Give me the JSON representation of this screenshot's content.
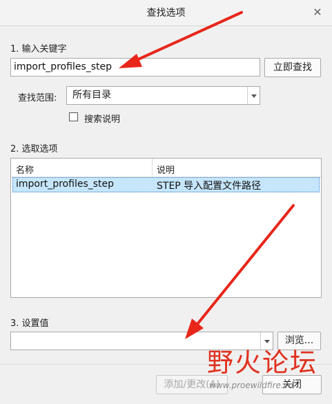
{
  "window": {
    "title": "查找选项",
    "close_glyph": "✕"
  },
  "step1": {
    "label": "1. 输入关键字",
    "keyword_value": "import_profiles_step",
    "search_button": "立即查找",
    "scope_label": "查找范围:",
    "scope_value": "所有目录",
    "search_desc_label": "搜索说明",
    "search_desc_checked": false
  },
  "step2": {
    "label": "2. 选取选项",
    "columns": [
      "名称",
      "说明"
    ],
    "rows": [
      {
        "name": "import_profiles_step",
        "desc": "STEP 导入配置文件路径",
        "selected": true
      }
    ]
  },
  "step3": {
    "label": "3. 设置值",
    "value": "",
    "browse_button": "浏览..."
  },
  "footer": {
    "add_change_button": "添加/更改(A)",
    "close_button": "关闭"
  },
  "watermark": {
    "logo": "野火论坛",
    "url": "www.proewildfire.cn"
  },
  "annotations": {
    "arrow_color": "#e8261a"
  }
}
